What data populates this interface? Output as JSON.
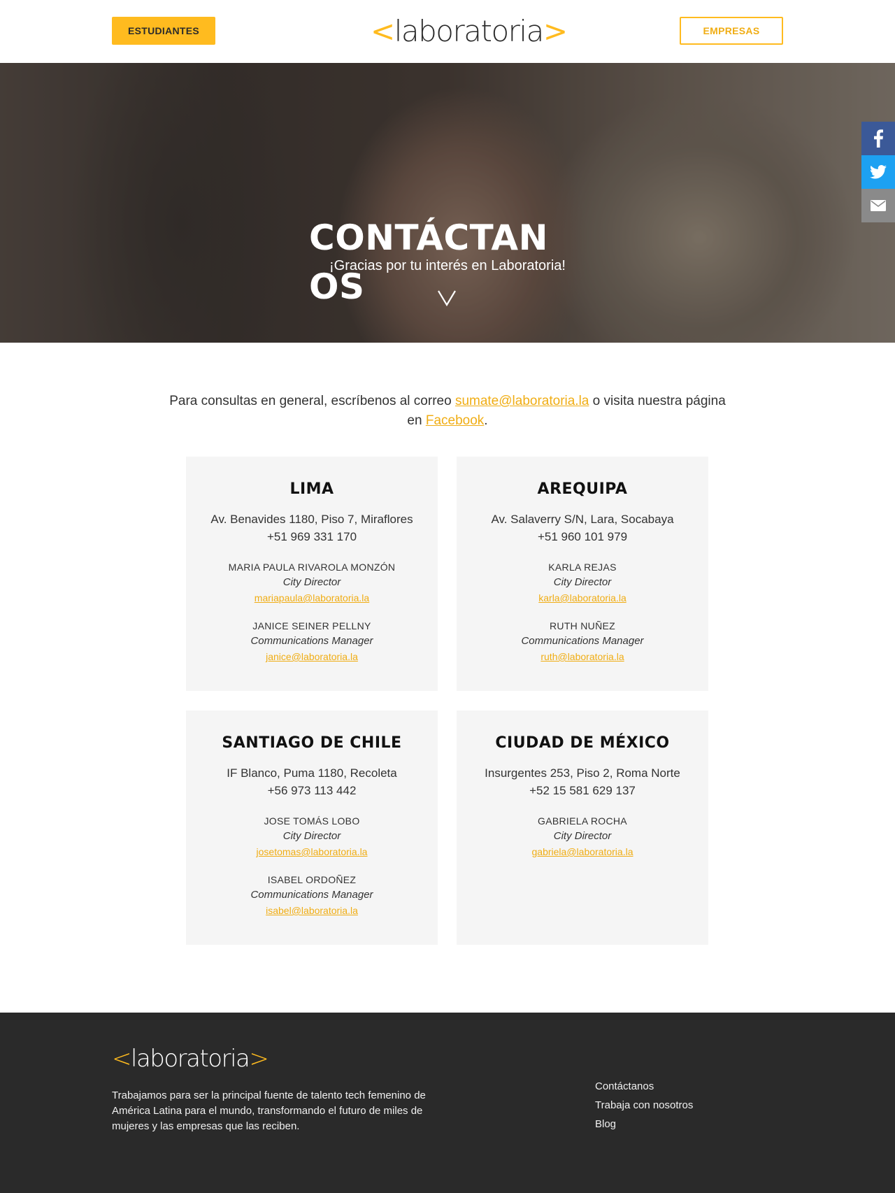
{
  "header": {
    "students_label": "ESTUDIANTES",
    "companies_label": "EMPRESAS",
    "logo_open": "<",
    "logo_text": "laboratoria",
    "logo_close": ">"
  },
  "hero": {
    "title": "CONTÁCTANOS",
    "subtitle": "¡Gracias por tu interés en Laboratoria!",
    "scroll_icon": "chevron-down-icon"
  },
  "social": {
    "items": [
      "facebook-icon",
      "twitter-icon",
      "envelope-icon"
    ],
    "colors": {
      "facebook": "#3b5998",
      "twitter": "#1da1f2",
      "mail": "#8a8a8a"
    }
  },
  "intro": {
    "text_before": "Para consultas en general, escríbenos al correo ",
    "email": "sumate@laboratoria.la",
    "text_middle": " o visita nuestra página en ",
    "facebook_link": "Facebook",
    "text_after": "."
  },
  "offices": [
    {
      "city": "LIMA",
      "address": "Av. Benavides 1180, Piso 7, Miraflores",
      "phone": "+51 969 331 170",
      "contacts": [
        {
          "name": "MARIA PAULA RIVAROLA MONZÓN",
          "role": "City Director",
          "email": "mariapaula@laboratoria.la"
        },
        {
          "name": "JANICE SEINER PELLNY",
          "role": "Communications Manager",
          "email": "janice@laboratoria.la"
        }
      ]
    },
    {
      "city": "AREQUIPA",
      "address": "Av. Salaverry S/N, Lara, Socabaya",
      "phone": "+51 960 101 979",
      "contacts": [
        {
          "name": "KARLA REJAS",
          "role": "City Director",
          "email": "karla@laboratoria.la"
        },
        {
          "name": "RUTH NUÑEZ",
          "role": "Communications Manager",
          "email": "ruth@laboratoria.la"
        }
      ]
    },
    {
      "city": "SANTIAGO DE CHILE",
      "address": "IF Blanco, Puma 1180, Recoleta",
      "phone": "+56 973 113 442",
      "contacts": [
        {
          "name": "JOSE TOMÁS LOBO",
          "role": "City Director",
          "email": "josetomas@laboratoria.la"
        },
        {
          "name": "ISABEL ORDOÑEZ",
          "role": "Communications Manager",
          "email": "isabel@laboratoria.la"
        }
      ]
    },
    {
      "city": "CIUDAD DE MÉXICO",
      "address": "Insurgentes 253, Piso 2, Roma Norte",
      "phone": "+52 15 581 629 137",
      "contacts": [
        {
          "name": "GABRIELA ROCHA",
          "role": "City Director",
          "email": "gabriela@laboratoria.la"
        }
      ]
    }
  ],
  "footer": {
    "logo_open": "<",
    "logo_text": "laboratoria",
    "logo_close": ">",
    "description": "Trabajamos para ser la principal fuente de talento tech femenino de América Latina para el mundo, transformando el futuro de miles de mujeres y las empresas que las reciben.",
    "links": [
      "Contáctanos",
      "Trabaja con nosotros",
      "Blog"
    ]
  },
  "colors": {
    "accent": "#ffbb1f",
    "footer_bg": "#2a2a2a",
    "card_bg": "#f5f5f5"
  }
}
